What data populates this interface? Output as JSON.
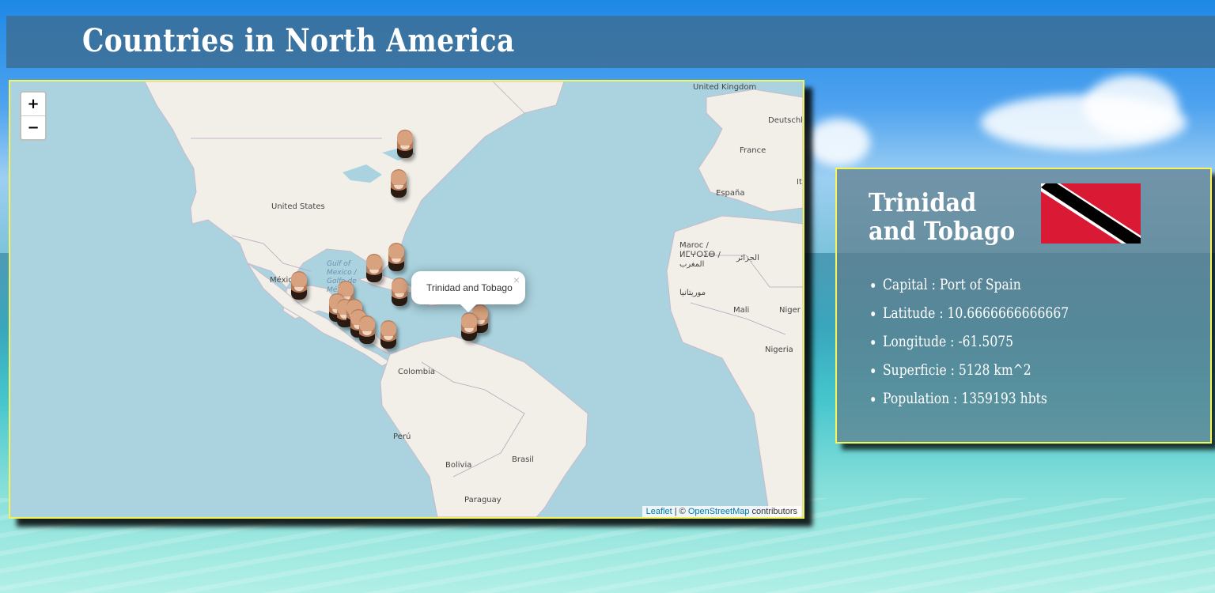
{
  "header": {
    "title": "Countries in North America"
  },
  "map": {
    "zoom_in_label": "+",
    "zoom_out_label": "−",
    "labels": {
      "united_kingdom": "United Kingdom",
      "deutschland": "Deutschl",
      "france": "France",
      "espana": "España",
      "italia": "It",
      "united_states": "United States",
      "mexico": "México",
      "gulf": "Gulf of Mexico / Golfo de México",
      "maroc": "Maroc / ⵍⵎⵖⵔⵉⴱ / المغرب",
      "algerie": "الجزائر",
      "mauritania": "موريتانيا",
      "mali": "Mali",
      "niger": "Niger",
      "nigeria": "Nigeria",
      "colombia": "Colombia",
      "peru": "Perú",
      "bolivia": "Bolivia",
      "brasil": "Brasil",
      "paraguay": "Paraguay"
    },
    "popup": {
      "text": "Trinidad and Tobago",
      "close": "×"
    },
    "attribution": {
      "leaflet": "Leaflet",
      "separator": " | © ",
      "osm": "OpenStreetMap",
      "suffix": " contributors"
    }
  },
  "info": {
    "country": "Trinidad and Tobago",
    "flag": {
      "red": "#DA1A35",
      "black": "#000000",
      "white": "#FFFFFF"
    },
    "items": [
      "Capital : Port of Spain",
      "Latitude : 10.6666666666667",
      "Longitude : -61.5075",
      "Superficie : 5128 km^2",
      "Population : 1359193 hbts"
    ]
  }
}
